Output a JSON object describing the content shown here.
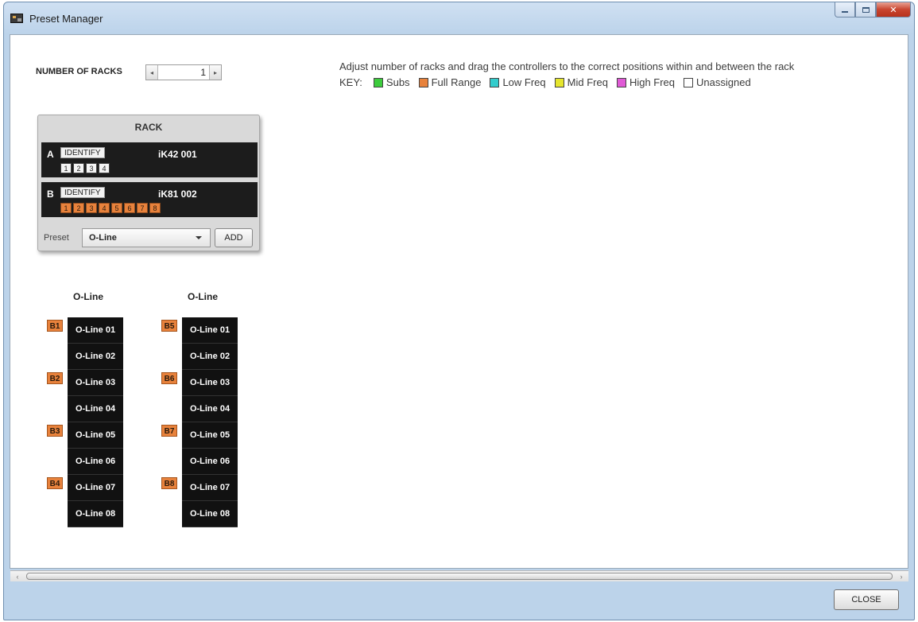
{
  "window": {
    "title": "Preset Manager"
  },
  "controls": {
    "racks_label": "NUMBER OF RACKS",
    "racks_value": "1",
    "spin_left": "◂",
    "spin_right": "▸"
  },
  "instructions": "Adjust number of racks and drag the controllers to the correct positions within and between the rack",
  "key": {
    "label": "KEY:",
    "items": [
      {
        "label": "Subs",
        "color": "#3dcc3d"
      },
      {
        "label": "Full Range",
        "color": "#e8823c"
      },
      {
        "label": "Low Freq",
        "color": "#33cccc"
      },
      {
        "label": "Mid Freq",
        "color": "#e6e62e"
      },
      {
        "label": "High Freq",
        "color": "#e05ad6"
      },
      {
        "label": "Unassigned",
        "color": "#ffffff"
      }
    ]
  },
  "rack": {
    "title": "RACK",
    "slots": [
      {
        "letter": "A",
        "identify": "IDENTIFY",
        "device": "iK42 001",
        "channels": [
          "1",
          "2",
          "3",
          "4"
        ],
        "channel_color": "white"
      },
      {
        "letter": "B",
        "identify": "IDENTIFY",
        "device": "iK81 002",
        "channels": [
          "1",
          "2",
          "3",
          "4",
          "5",
          "6",
          "7",
          "8"
        ],
        "channel_color": "orange"
      }
    ],
    "preset_label": "Preset",
    "preset_value": "O-Line",
    "add_label": "ADD"
  },
  "columns": [
    {
      "title": "O-Line",
      "speakers": [
        "O-Line 01",
        "O-Line 02",
        "O-Line 03",
        "O-Line 04",
        "O-Line 05",
        "O-Line 06",
        "O-Line 07",
        "O-Line 08"
      ],
      "badges": [
        "B1",
        "B2",
        "B3",
        "B4"
      ]
    },
    {
      "title": "O-Line",
      "speakers": [
        "O-Line 01",
        "O-Line 02",
        "O-Line 03",
        "O-Line 04",
        "O-Line 05",
        "O-Line 06",
        "O-Line 07",
        "O-Line 08"
      ],
      "badges": [
        "B5",
        "B6",
        "B7",
        "B8"
      ]
    }
  ],
  "footer": {
    "close_label": "CLOSE"
  }
}
